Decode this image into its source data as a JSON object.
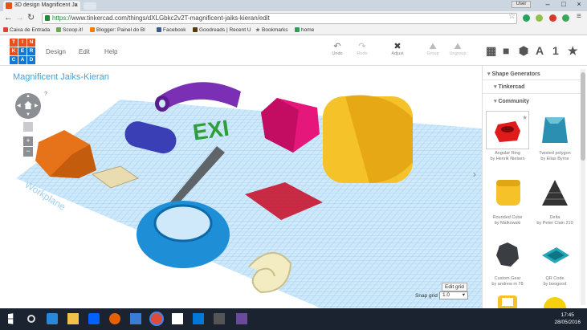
{
  "browser": {
    "tab_title": "3D design Magnificent Ja",
    "user_label": "User",
    "url_scheme": "https://",
    "url_rest": "www.tinkercad.com/things/dXLGbkc2v2T-magnificent-jaiks-kieran/edit",
    "bookmarks": [
      {
        "label": "Caixa de Entrada",
        "icon": "mail-icon",
        "color": "#d44638"
      },
      {
        "label": "Scoop.it!",
        "icon": "scoopit-icon",
        "color": "#6aa84f"
      },
      {
        "label": "Blogger: Painel do Bl",
        "icon": "blogger-icon",
        "color": "#f57d00"
      },
      {
        "label": "Facebook",
        "icon": "facebook-icon",
        "color": "#3b5998"
      },
      {
        "label": "Goodreads | Recent U",
        "icon": "goodreads-icon",
        "color": "#553b08"
      },
      {
        "label": "Bookmarks",
        "icon": "star-icon",
        "color": "#666666"
      },
      {
        "label": "home",
        "icon": "home-icon",
        "color": "#2e9e5b"
      }
    ]
  },
  "app": {
    "logo_letters": [
      "TIN",
      "KER",
      "CAD"
    ],
    "menu": [
      "Design",
      "Edit",
      "Help"
    ],
    "tools": [
      {
        "label": "Undo",
        "glyph": "↶",
        "enabled": true
      },
      {
        "label": "Redo",
        "glyph": "↷",
        "enabled": false
      },
      {
        "label": "Adjust",
        "glyph": "✖",
        "enabled": true
      },
      {
        "label": "Group",
        "glyph": "⛰",
        "enabled": false
      },
      {
        "label": "Ungroup",
        "glyph": "⛰",
        "enabled": false
      }
    ],
    "view_icons": [
      "▦",
      "■",
      "⬢",
      "A",
      "1",
      "★"
    ]
  },
  "canvas": {
    "design_title": "Magnificent Jaiks-Kieran",
    "workplane_label": "Workplane",
    "help_label": "?",
    "zoom_in": "+",
    "zoom_out": "−",
    "edit_grid": "Edit grid",
    "snap_grid_label": "Snap grid",
    "snap_grid_value": "1.0",
    "collapse_glyph": "›",
    "shapes_text": "EXI"
  },
  "sidebar": {
    "section": "Shape Generators",
    "groups": [
      "Tinkercad",
      "Community"
    ],
    "cards": [
      {
        "title": "Angular Ring",
        "author": "by Henrik Nielsen"
      },
      {
        "title": "Twisted polygon",
        "author": "by Elias Byrne"
      },
      {
        "title": "Rounded Cube",
        "author": "by Malkowski"
      },
      {
        "title": "Delta",
        "author": "by Peter Clain 210"
      },
      {
        "title": "Custom Gear",
        "author": "by andrew m 78"
      },
      {
        "title": "QR Code",
        "author": "by boogood"
      }
    ]
  },
  "taskbar": {
    "time": "17:45",
    "date": "28/05/2016"
  }
}
